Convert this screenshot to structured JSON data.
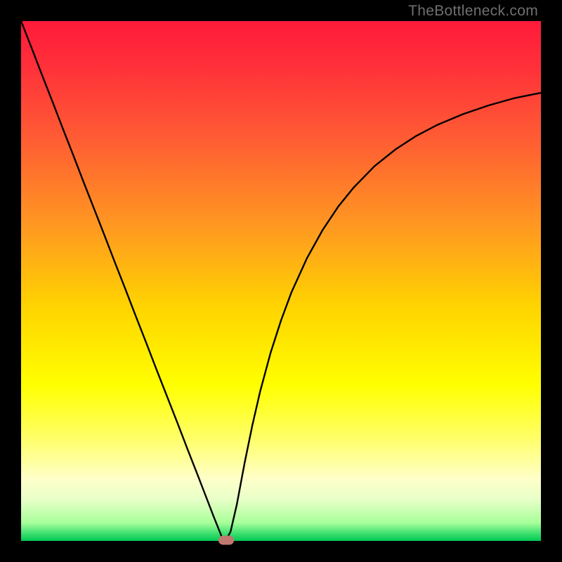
{
  "watermark": "TheBottleneck.com",
  "chart_data": {
    "type": "line",
    "title": "",
    "xlabel": "",
    "ylabel": "",
    "xlim": [
      0,
      1
    ],
    "ylim": [
      0,
      1
    ],
    "background_gradient": {
      "stops": [
        {
          "offset": 0.0,
          "color": "#ff1a3a"
        },
        {
          "offset": 0.08,
          "color": "#ff2e3a"
        },
        {
          "offset": 0.22,
          "color": "#ff5a34"
        },
        {
          "offset": 0.4,
          "color": "#ff9a20"
        },
        {
          "offset": 0.55,
          "color": "#ffd400"
        },
        {
          "offset": 0.7,
          "color": "#ffff00"
        },
        {
          "offset": 0.8,
          "color": "#ffff66"
        },
        {
          "offset": 0.88,
          "color": "#ffffc8"
        },
        {
          "offset": 0.92,
          "color": "#e8ffc8"
        },
        {
          "offset": 0.965,
          "color": "#a8ff9a"
        },
        {
          "offset": 0.985,
          "color": "#40e070"
        },
        {
          "offset": 1.0,
          "color": "#00c853"
        }
      ]
    },
    "series": [
      {
        "name": "bottleneck-curve",
        "x": [
          0.0,
          0.02,
          0.04,
          0.06,
          0.08,
          0.1,
          0.12,
          0.14,
          0.16,
          0.18,
          0.2,
          0.22,
          0.24,
          0.26,
          0.28,
          0.3,
          0.32,
          0.34,
          0.355,
          0.37,
          0.38,
          0.388,
          0.395,
          0.403,
          0.415,
          0.43,
          0.445,
          0.46,
          0.48,
          0.5,
          0.52,
          0.55,
          0.58,
          0.61,
          0.64,
          0.68,
          0.72,
          0.76,
          0.8,
          0.85,
          0.9,
          0.95,
          1.0
        ],
        "y": [
          1.0,
          0.949,
          0.897,
          0.846,
          0.794,
          0.743,
          0.691,
          0.64,
          0.589,
          0.537,
          0.486,
          0.434,
          0.383,
          0.331,
          0.28,
          0.229,
          0.177,
          0.126,
          0.087,
          0.048,
          0.023,
          0.003,
          0.003,
          0.018,
          0.07,
          0.15,
          0.223,
          0.288,
          0.362,
          0.424,
          0.478,
          0.544,
          0.598,
          0.643,
          0.68,
          0.721,
          0.753,
          0.779,
          0.8,
          0.821,
          0.838,
          0.852,
          0.862
        ]
      }
    ],
    "marker": {
      "x": 0.395,
      "y": 0.002,
      "color": "#c1786f"
    }
  }
}
